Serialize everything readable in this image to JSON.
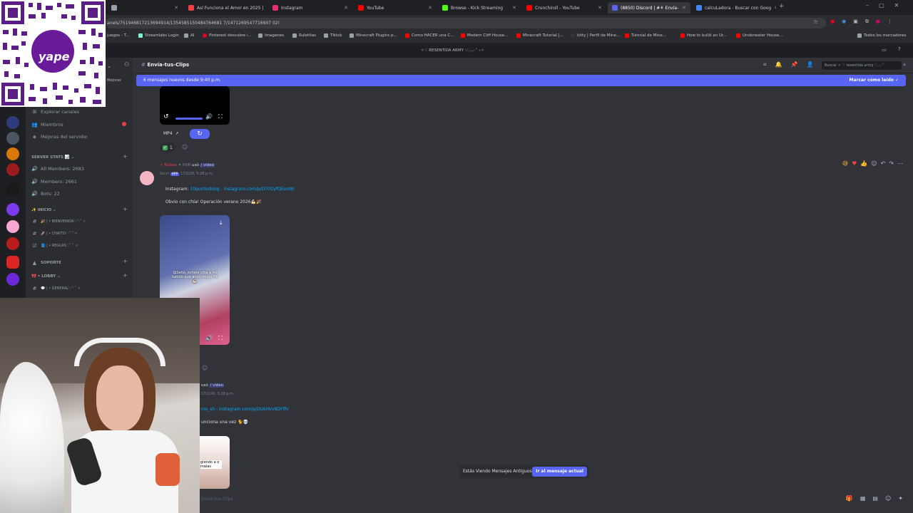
{
  "browser": {
    "tabs": [
      {
        "label": "",
        "color": "#9aa0a6"
      },
      {
        "label": "Así Funciona el Amor en 2025 |",
        "color": "#f23f43"
      },
      {
        "label": "Instagram",
        "color": "#e1306c"
      },
      {
        "label": "YouTube",
        "color": "#ff0000"
      },
      {
        "label": "Browse - Kick Streaming",
        "color": "#53fc18"
      },
      {
        "label": "Crunchiroll - YouTube",
        "color": "#ff0000"
      },
      {
        "label": "(8850) Discord | #⚘ Envía-",
        "color": "#5865f2"
      },
      {
        "label": "calcuLadora - Buscar con Goog",
        "color": "#4285f4"
      }
    ],
    "url": "anels/751946817213694914/1354585150484764681 7/1471269547716907 02!",
    "bookmarks": [
      {
        "label": "juegos - T...",
        "color": "#9aa0a6"
      },
      {
        "label": "Streamlabs Login",
        "color": "#80f5d2"
      },
      {
        "label": "AI",
        "color": "#9aa0a6"
      },
      {
        "label": "Pinterest descubre i...",
        "color": "#e60023"
      },
      {
        "label": "Imagenes",
        "color": "#9aa0a6"
      },
      {
        "label": "Ruletitas",
        "color": "#9aa0a6"
      },
      {
        "label": "Tiktok",
        "color": "#9aa0a6"
      },
      {
        "label": "Minecraft Plugins p...",
        "color": "#9aa0a6"
      },
      {
        "label": "Como HACER una C...",
        "color": "#ff0000"
      },
      {
        "label": "Modern Cliff House...",
        "color": "#ff0000"
      },
      {
        "label": "Minecraft Tutorial |...",
        "color": "#ff0000"
      },
      {
        "label": "kitty | Perfil de Mine...",
        "color": "#333333"
      },
      {
        "label": "Tutorial de Mine...",
        "color": "#ff0000"
      },
      {
        "label": "How to build an Ur...",
        "color": "#ff0000"
      },
      {
        "label": "Underwater House...",
        "color": "#ff0000"
      },
      {
        "label": "Todos los marcadores",
        "color": "#9aa0a6"
      }
    ]
  },
  "discord": {
    "window_title": "✧♡ RESENTIDA ARMY ♡⸝⸝⸝·˚ ₊✧",
    "sidebar": {
      "items": [
        {
          "label": "Explorar canales",
          "icon": "compass-icon"
        },
        {
          "label": "Miembros",
          "icon": "members-icon"
        },
        {
          "label": "Mejoras del servidor",
          "icon": "boost-icon"
        },
        {
          "label": "SERVER STATS 📊 ⌄",
          "category": true
        },
        {
          "label": "All Members: 2683",
          "icon": "voice-icon"
        },
        {
          "label": "Members: 2661",
          "icon": "voice-icon"
        },
        {
          "label": "Bots: 22",
          "icon": "voice-icon"
        },
        {
          "label": "✨ INICIO ⌄",
          "category": true
        },
        {
          "label": "🎉 | • BIENVENIDA♡˚·˚ ✧",
          "icon": "hash-icon"
        },
        {
          "label": "🚀 | • CHAITO♡˚·˚ ✧",
          "icon": "hash-icon"
        },
        {
          "label": "📘 | • REGLAS♡˚·˚ ✧",
          "icon": "rules-icon"
        },
        {
          "label": "SOPORTE",
          "category": true
        },
        {
          "label": "🎀 • LOBBY ⌄",
          "category": true
        },
        {
          "label": "💬 | • GENERAL♡˚·˚ ✧",
          "icon": "hash-icon"
        }
      ],
      "mejoras_label": "Mejoras"
    },
    "channel": {
      "name": "Envía-tus-Clips",
      "search_placeholder": "Buscar ✧ ♡ resentida army ♡⸝⸝·˚"
    },
    "new_messages": {
      "text": "6 mensajes nuevos desde 9:40 p.m.",
      "mark_read": "Marcar como leído"
    },
    "messages": [
      {
        "format": "MP4",
        "reaction_count": "1"
      },
      {
        "author": "✧ Nubes",
        "role": "✦ HSR",
        "uses": "usó",
        "command": "/ video",
        "sub": "Socci",
        "app": "APP",
        "time": "17/2/26, 5:28 p.m.",
        "instagram_prefix": "Instagram:",
        "instagram_user": "10puntosblog",
        "instagram_url": "- instagram.com/p/DT0DyfQEeoW/",
        "text": "Obvio con chía! Operación verano 2026💪🏻🎉",
        "video_caption": "😋Señó, echele chía a mi batido que ando modo Fit💪🏻"
      },
      {
        "uses": "usó",
        "command": "/ video",
        "time": "17/2/26, 5:28 p.m.",
        "instagram_user": "ros_sh",
        "instagram_url": "- instagram.com/p/DUkHVv8DFfR/",
        "text": "unciona una vez 🐈💀",
        "video_caption": "giendo a o malas"
      }
    ],
    "old_messages": {
      "text": "Estás Viendo Mensajes Antiguos",
      "jump": "Ir al mensaje actual"
    },
    "composer_placeholder": "Envía-tus-Clips"
  },
  "overlay": {
    "qr_brand": "yape"
  }
}
